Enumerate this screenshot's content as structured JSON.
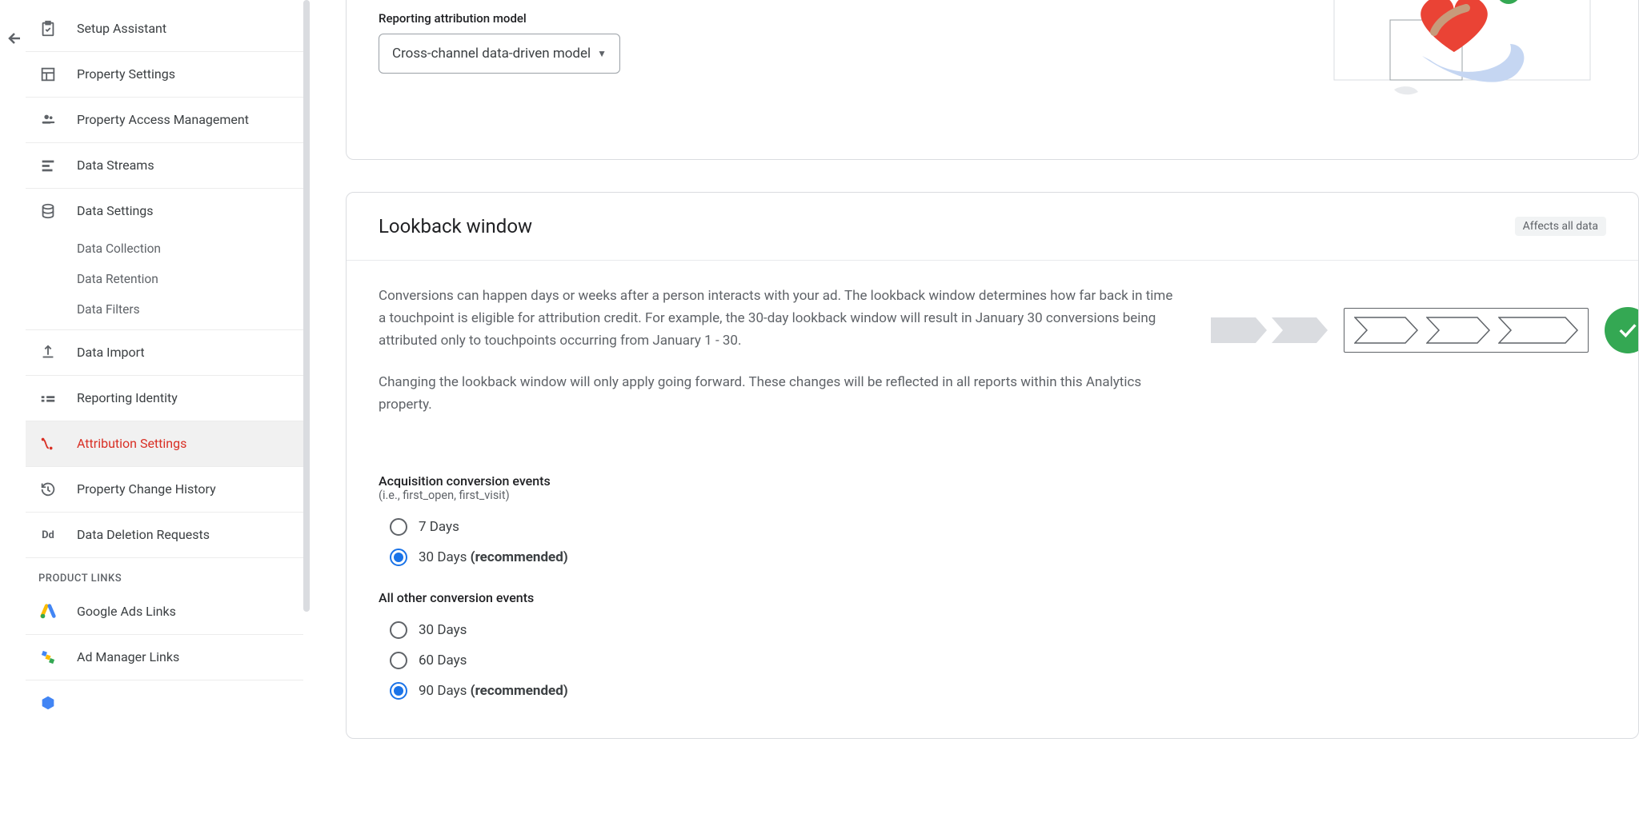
{
  "sidebar": {
    "items": [
      {
        "label": "Setup Assistant"
      },
      {
        "label": "Property Settings"
      },
      {
        "label": "Property Access Management"
      },
      {
        "label": "Data Streams"
      },
      {
        "label": "Data Settings"
      },
      {
        "label": "Data Import"
      },
      {
        "label": "Reporting Identity"
      },
      {
        "label": "Attribution Settings"
      },
      {
        "label": "Property Change History"
      },
      {
        "label": "Data Deletion Requests"
      }
    ],
    "sub": {
      "dataSettings": [
        "Data Collection",
        "Data Retention",
        "Data Filters"
      ]
    },
    "sectionTitle": "PRODUCT LINKS",
    "productLinks": [
      "Google Ads Links",
      "Ad Manager Links"
    ]
  },
  "attribution": {
    "fieldLabel": "Reporting attribution model",
    "dropdownValue": "Cross-channel data-driven model"
  },
  "lookback": {
    "title": "Lookback window",
    "badge": "Affects all data",
    "para1": "Conversions can happen days or weeks after a person interacts with your ad. The lookback window determines how far back in time a touchpoint is eligible for attribution credit. For example, the 30-day lookback window will result in January 30 conversions being attributed only to touchpoints occurring from January 1 - 30.",
    "para2": "Changing the lookback window will only apply going forward. These changes will be reflected in all reports within this Analytics property.",
    "acq": {
      "title": "Acquisition conversion events",
      "sub": "(i.e., first_open, first_visit)",
      "options": [
        {
          "label": "7 Days",
          "checked": false
        },
        {
          "label": "30 Days ",
          "rec": "(recommended)",
          "checked": true
        }
      ]
    },
    "other": {
      "title": "All other conversion events",
      "options": [
        {
          "label": "30 Days",
          "checked": false
        },
        {
          "label": "60 Days",
          "checked": false
        },
        {
          "label": "90 Days ",
          "rec": "(recommended)",
          "checked": true
        }
      ]
    }
  }
}
